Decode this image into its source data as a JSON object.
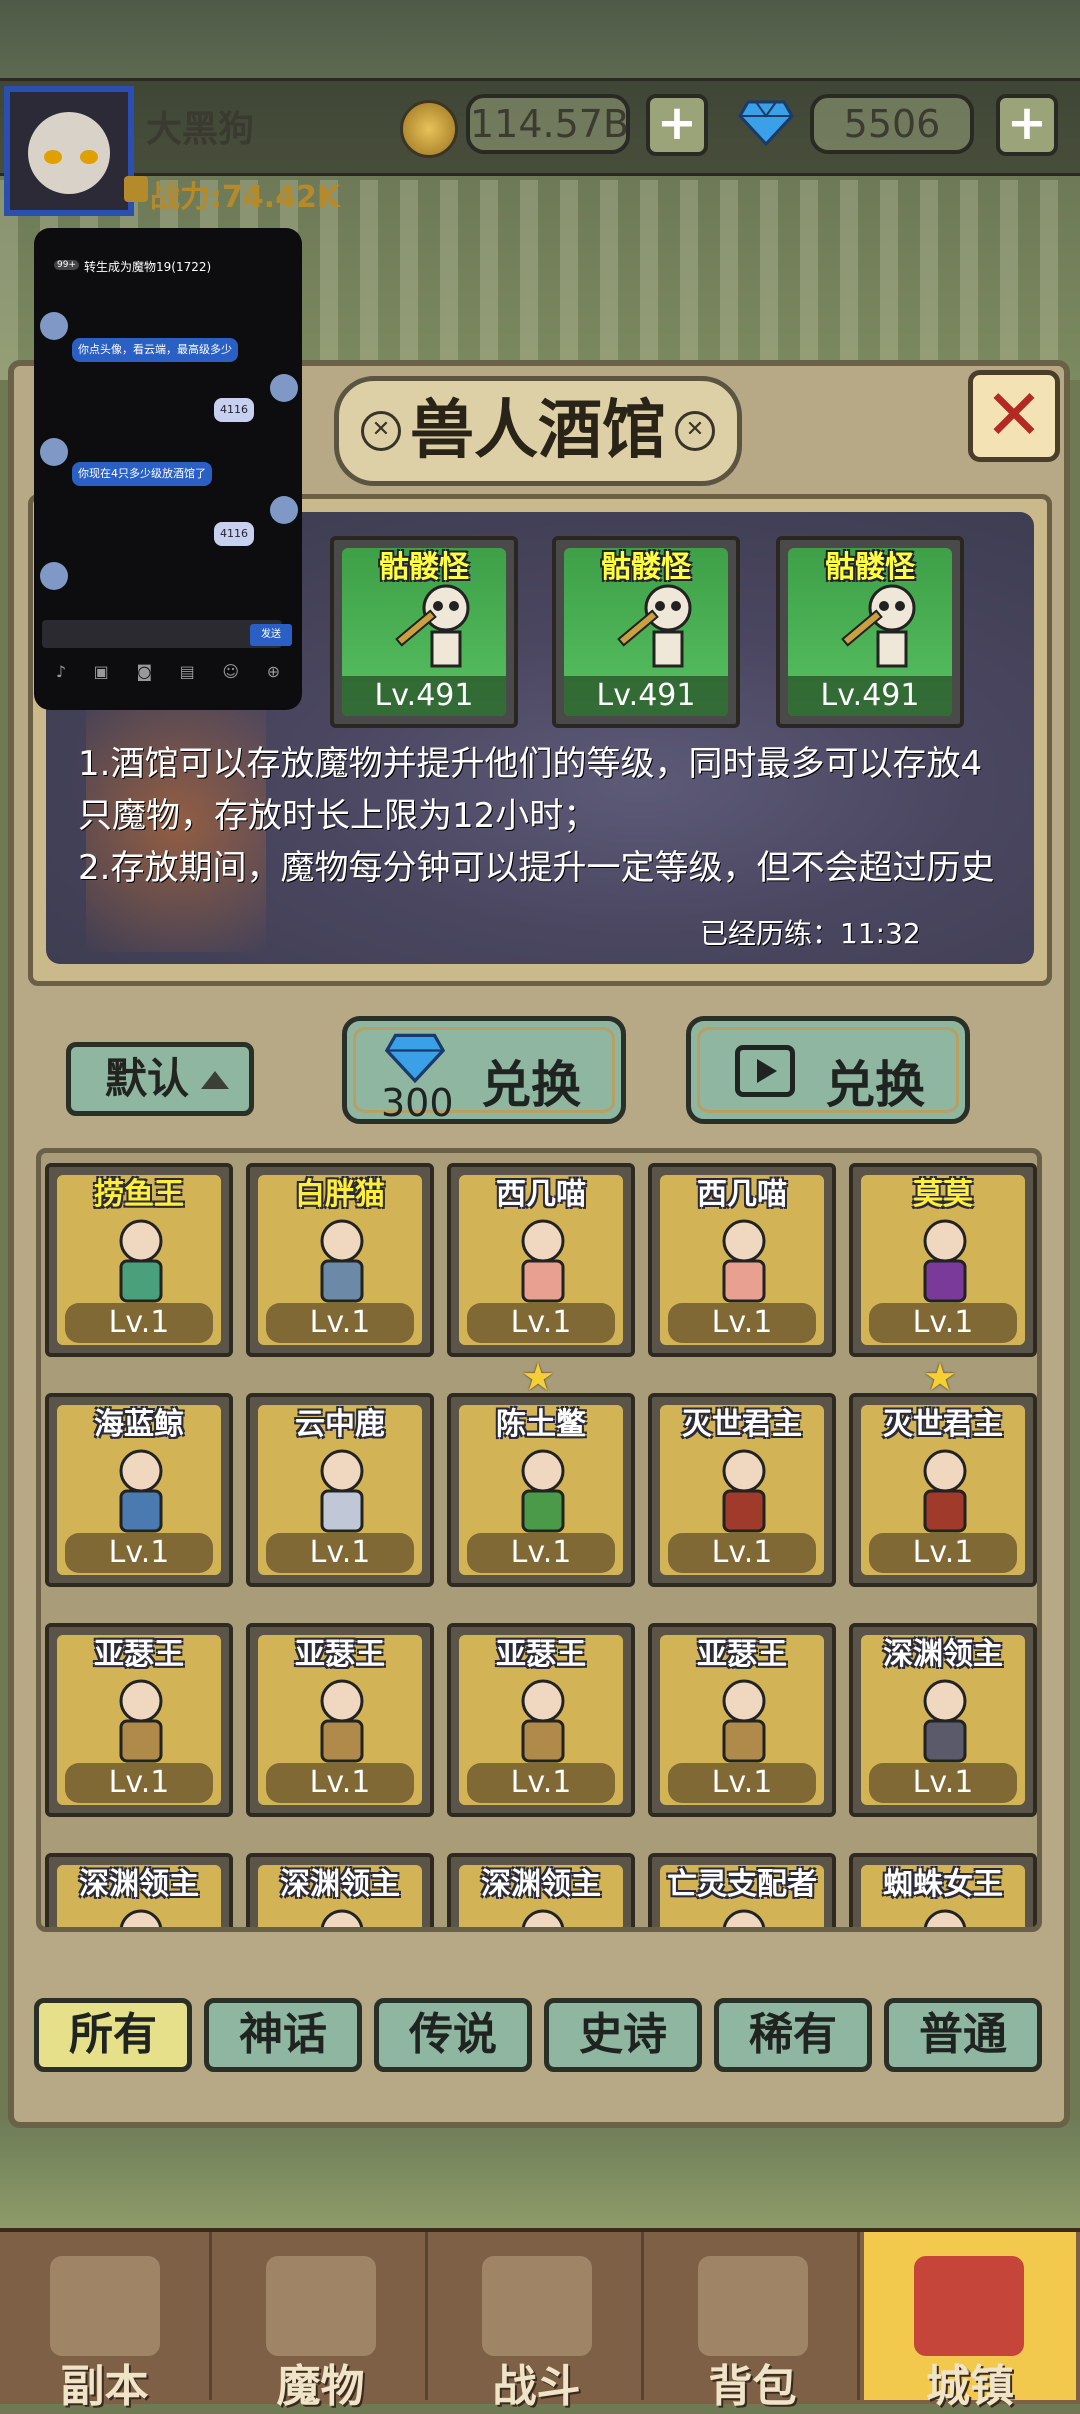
{
  "header": {
    "player_name": "大黑狗",
    "power": "战力:74.42K",
    "coins": "114.57B",
    "gems": "5506",
    "plus": "+"
  },
  "chat": {
    "title": "转生成为魔物19(1722)",
    "badge": "99+",
    "msg1": "你点头像，看云端，最高级多少",
    "msg2": "你现在4只多少级放酒馆了",
    "val1": "4116",
    "val2": "4116",
    "send": "发送"
  },
  "panel": {
    "title": "兽人酒馆",
    "close": "✕",
    "tavern_slots": [
      {
        "name": "骷髅怪",
        "level": "Lv.491"
      },
      {
        "name": "骷髅怪",
        "level": "Lv.491"
      },
      {
        "name": "骷髅怪",
        "level": "Lv.491"
      }
    ],
    "desc_line1": "1.酒馆可以存放魔物并提升他们的等级，同时最多可以存放4",
    "desc_line2": "只魔物，存放时长上限为12小时；",
    "desc_line3": "2.存放期间，魔物每分钟可以提升一定等级，但不会超过历史",
    "timer": "已经历练：11:32"
  },
  "controls": {
    "sort_label": "默认",
    "exchange_gem_cost": "300",
    "exchange_label": "兑换",
    "exchange_ad_label": "兑换"
  },
  "monsters": [
    {
      "name": "捞鱼王",
      "level": "Lv.1",
      "gold": true,
      "color": "#4aa07a"
    },
    {
      "name": "白胖猫",
      "level": "Lv.1",
      "gold": true,
      "color": "#6a8aa8"
    },
    {
      "name": "西几喵",
      "level": "Lv.1",
      "gold": false,
      "color": "#e8a090"
    },
    {
      "name": "西几喵",
      "level": "Lv.1",
      "gold": false,
      "color": "#e8a090"
    },
    {
      "name": "莫莫",
      "level": "Lv.1",
      "gold": true,
      "color": "#7a3a9a"
    },
    {
      "name": "海蓝鲸",
      "level": "Lv.1",
      "gold": false,
      "color": "#4a7ab0"
    },
    {
      "name": "云中鹿",
      "level": "Lv.1",
      "gold": false,
      "color": "#c0c8d8"
    },
    {
      "name": "陈土鳖",
      "level": "Lv.1",
      "gold": false,
      "color": "#4a9a4a"
    },
    {
      "name": "灭世君主",
      "level": "Lv.1",
      "gold": false,
      "color": "#a03a2a"
    },
    {
      "name": "灭世君主",
      "level": "Lv.1",
      "gold": false,
      "color": "#a03a2a"
    },
    {
      "name": "亚瑟王",
      "level": "Lv.1",
      "gold": false,
      "color": "#b08a4a"
    },
    {
      "name": "亚瑟王",
      "level": "Lv.1",
      "gold": false,
      "color": "#b08a4a"
    },
    {
      "name": "亚瑟王",
      "level": "Lv.1",
      "gold": false,
      "color": "#b08a4a"
    },
    {
      "name": "亚瑟王",
      "level": "Lv.1",
      "gold": false,
      "color": "#b08a4a"
    },
    {
      "name": "深渊领主",
      "level": "Lv.1",
      "gold": false,
      "color": "#5a5a6a"
    },
    {
      "name": "深渊领主",
      "level": "",
      "gold": false,
      "color": "#5a5a6a"
    },
    {
      "name": "深渊领主",
      "level": "",
      "gold": false,
      "color": "#5a5a6a"
    },
    {
      "name": "深渊领主",
      "level": "",
      "gold": false,
      "color": "#5a5a6a"
    },
    {
      "name": "亡灵支配者",
      "level": "",
      "gold": false,
      "color": "#4a3a6a"
    },
    {
      "name": "蜘蛛女王",
      "level": "",
      "gold": false,
      "color": "#b03a4a"
    }
  ],
  "filters": [
    "所有",
    "神话",
    "传说",
    "史诗",
    "稀有",
    "普通"
  ],
  "nav": [
    {
      "label": "副本",
      "icon": "map-icon"
    },
    {
      "label": "魔物",
      "icon": "monster-icon"
    },
    {
      "label": "战斗",
      "icon": "swords-icon"
    },
    {
      "label": "背包",
      "icon": "backpack-icon"
    },
    {
      "label": "城镇",
      "icon": "town-icon"
    }
  ]
}
